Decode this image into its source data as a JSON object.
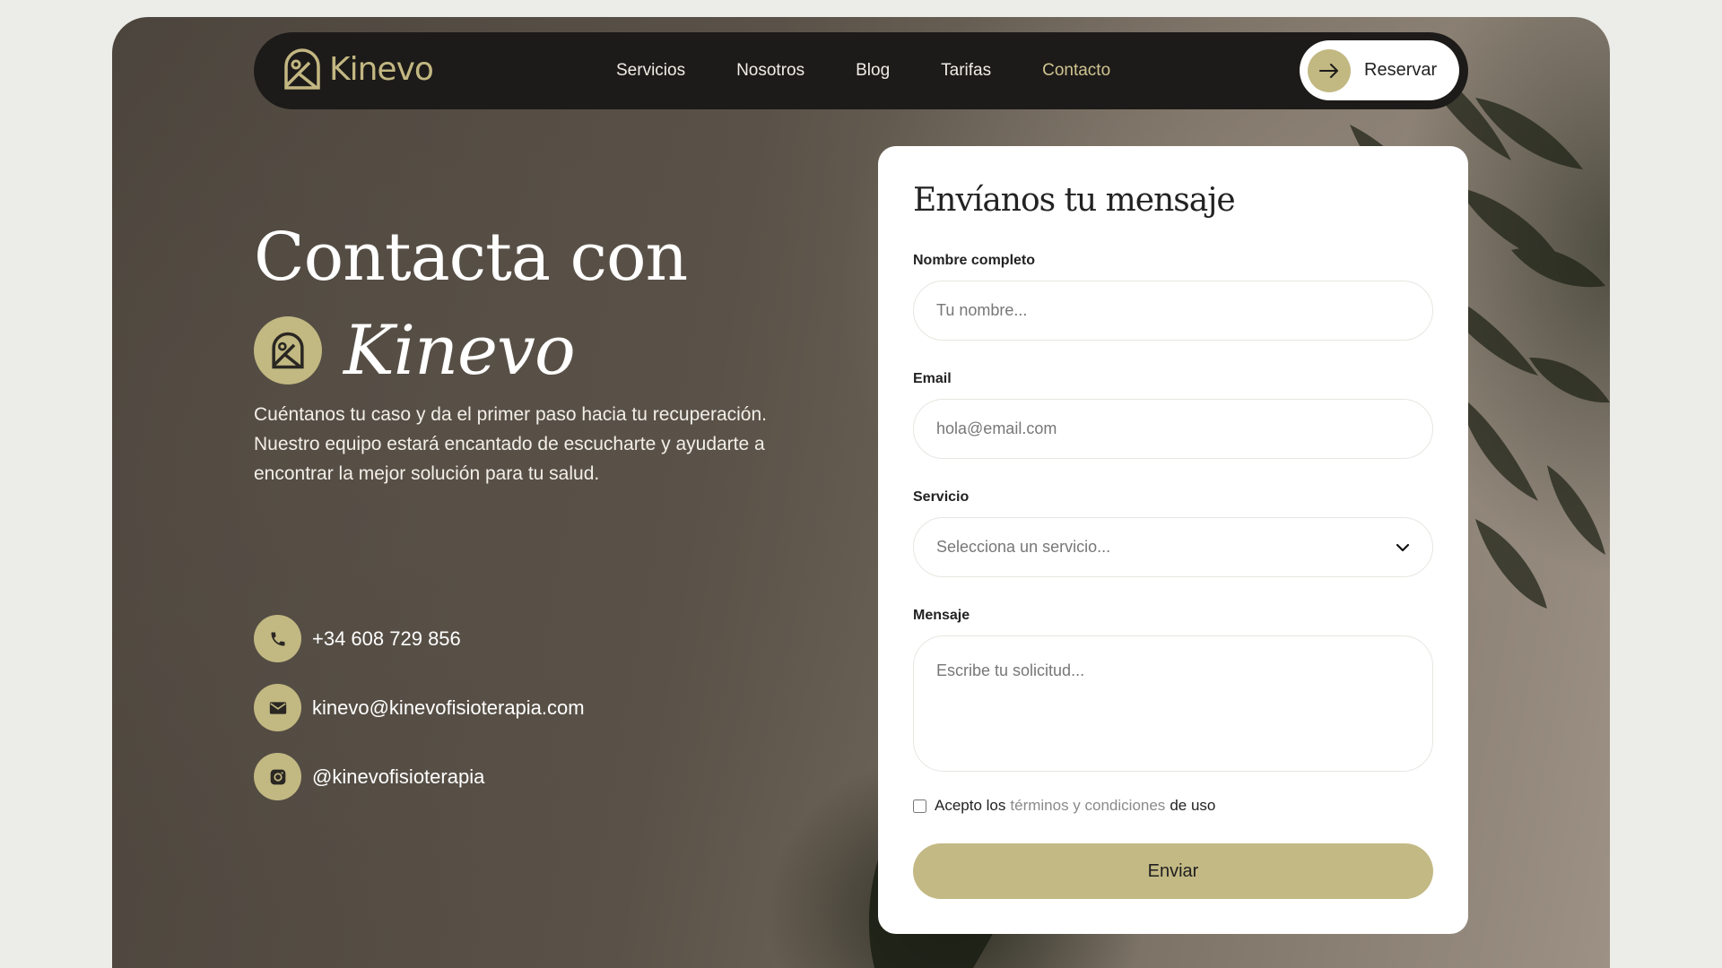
{
  "colors": {
    "accent": "#c2b882",
    "nav_bg": "#1d1b19",
    "active_link": "#cfc391"
  },
  "nav": {
    "logo_text": "Kinevo",
    "links": [
      {
        "label": "Servicios",
        "active": false
      },
      {
        "label": "Nosotros",
        "active": false
      },
      {
        "label": "Blog",
        "active": false
      },
      {
        "label": "Tarifas",
        "active": false
      },
      {
        "label": "Contacto",
        "active": true
      }
    ],
    "reserve_label": "Reservar",
    "reserve_icon": "arrow-right-icon"
  },
  "hero": {
    "title_line1": "Contacta con",
    "title_brand": "Kinevo",
    "description": "Cuéntanos tu caso y da el primer paso hacia tu recuperación. Nuestro equipo estará encantado de escucharte y ayudarte a encontrar la mejor solución para tu salud."
  },
  "contacts": [
    {
      "icon": "phone-icon",
      "text": "+34 608 729 856"
    },
    {
      "icon": "mail-icon",
      "text": "kinevo@kinevofisioterapia.com"
    },
    {
      "icon": "instagram-icon",
      "text": "@kinevofisioterapia"
    }
  ],
  "form": {
    "title": "Envíanos tu mensaje",
    "name": {
      "label": "Nombre completo",
      "placeholder": "Tu nombre...",
      "value": ""
    },
    "email": {
      "label": "Email",
      "placeholder": "hola@email.com",
      "value": ""
    },
    "service": {
      "label": "Servicio",
      "selected": "Selecciona un servicio..."
    },
    "message": {
      "label": "Mensaje",
      "placeholder": "Escribe tu solicitud...",
      "value": ""
    },
    "terms": {
      "prefix": "Acepto los",
      "link": "términos y condiciones",
      "suffix": "de uso",
      "checked": false
    },
    "submit_label": "Enviar"
  }
}
